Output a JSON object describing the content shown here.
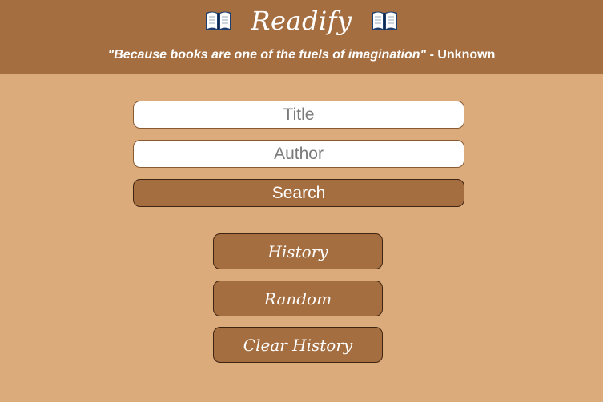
{
  "header": {
    "title": "Readify",
    "icon_left": "open-book-icon",
    "icon_right": "open-book-icon",
    "quote": "\"Because books are one of the fuels of imagination\"",
    "quote_author": " - Unknown"
  },
  "search": {
    "title_placeholder": "Title",
    "title_value": "",
    "author_placeholder": "Author",
    "author_value": "",
    "search_label": "Search"
  },
  "actions": {
    "history_label": "History",
    "random_label": "Random",
    "clear_label": "Clear History"
  },
  "colors": {
    "header_bg": "#a56e40",
    "page_bg": "#dcab7b",
    "button_bg": "#a56e40",
    "text_light": "#ffffff"
  }
}
